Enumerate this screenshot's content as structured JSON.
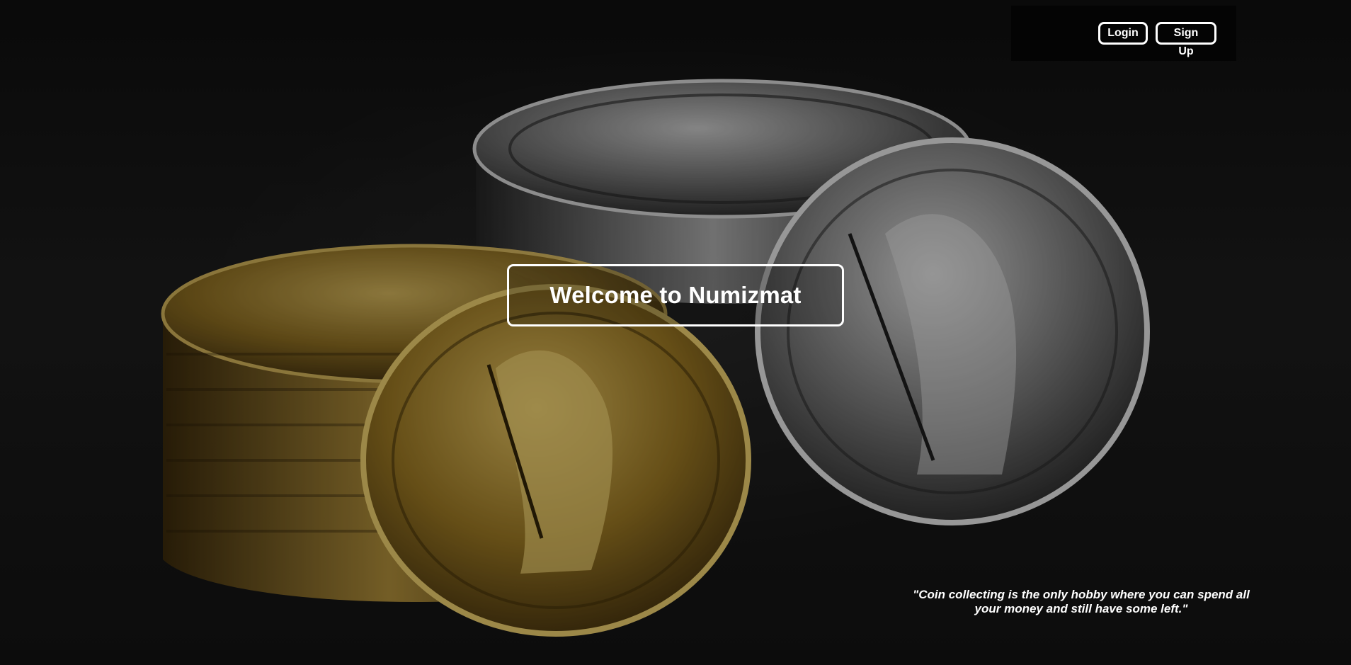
{
  "header": {
    "login_label": "Login",
    "signup_label": "Sign Up"
  },
  "hero": {
    "title": "Welcome to Numizmat",
    "quote": "\"Coin collecting is the only hobby where you can spend all your money and still have some left.\""
  },
  "colors": {
    "text": "#ffffff",
    "background": "#111111",
    "gold": "#b79a45",
    "silver": "#a6a6a6"
  },
  "visual_elements": [
    "gold-coin-stack",
    "silver-coin-stack",
    "gold-britannia-coin",
    "silver-britannia-coin"
  ]
}
